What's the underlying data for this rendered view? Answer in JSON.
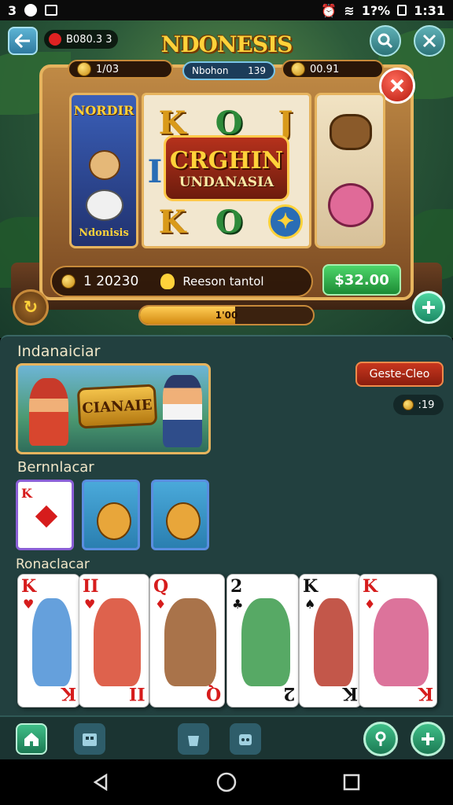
{
  "status_bar": {
    "left_text": "3",
    "battery": "1?%",
    "time": "1:31"
  },
  "header": {
    "game_title": "NDONESIS",
    "coin_balance": "B080.3 3",
    "back_icon": "back-arrow-icon",
    "search_icon": "search-icon",
    "close_icon": "close-icon"
  },
  "machine": {
    "pill_left": "1/03",
    "pill_center_label": "Nbohon",
    "pill_center_value": "139",
    "pill_right": "00.91",
    "left_panel_title": "NORDIR",
    "left_panel_bottom": "Ndonisis",
    "banner_line1": "CRGHIN",
    "banner_line2": "UNDANASIA",
    "reel_symbols": [
      "K",
      "O",
      "J",
      "I",
      "K",
      "O"
    ],
    "credits": "1 20230",
    "reason_text": "Reeson tantol",
    "bet_value": "$32.00",
    "progress_label": "1'00",
    "progress": 0.55
  },
  "lower": {
    "section1_title": "Indanaiciar",
    "featured_label": "CIANAIE",
    "red_button": "Geste-Cleo",
    "dark_pill_value": ":19",
    "section2_title": "Bernnlacar",
    "section3_title": "Ronaclacar",
    "tiles": [
      {
        "rank": "K"
      },
      {
        "rank": ""
      },
      {
        "rank": ""
      }
    ],
    "cards": [
      {
        "rank": "K",
        "suit": "♥",
        "color": "#d61c1c"
      },
      {
        "rank": "II",
        "suit": "♥",
        "color": "#d61c1c"
      },
      {
        "rank": "Q",
        "suit": "♦",
        "color": "#d61c1c"
      },
      {
        "rank": "2",
        "suit": "♣",
        "color": "#111111"
      },
      {
        "rank": "K",
        "suit": "♠",
        "color": "#111111"
      },
      {
        "rank": "K",
        "suit": "♦",
        "color": "#d61c1c"
      }
    ]
  },
  "tabs": [
    "home-icon",
    "calendar-icon",
    "bag-icon",
    "chest-icon",
    "user-icon",
    "add-icon"
  ],
  "nav": [
    "nav-back-icon",
    "nav-home-icon",
    "nav-recents-icon"
  ]
}
